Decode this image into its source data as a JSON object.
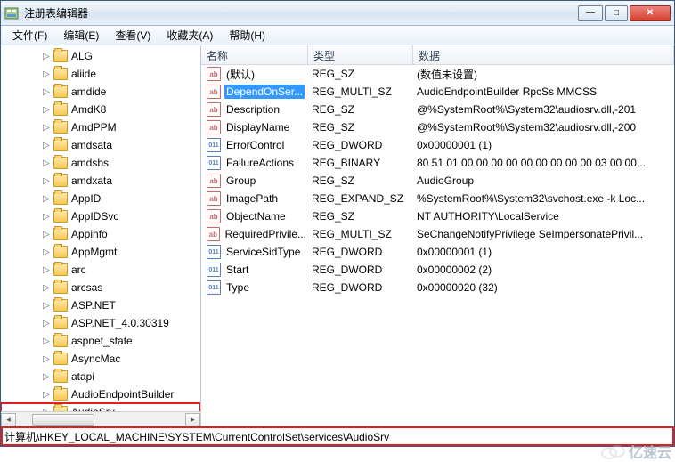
{
  "window": {
    "title": "注册表编辑器"
  },
  "menu": {
    "file": "文件(F)",
    "edit": "编辑(E)",
    "view": "查看(V)",
    "favorites": "收藏夹(A)",
    "help": "帮助(H)"
  },
  "tree": {
    "items": [
      {
        "label": "ALG"
      },
      {
        "label": "aliide"
      },
      {
        "label": "amdide"
      },
      {
        "label": "AmdK8"
      },
      {
        "label": "AmdPPM"
      },
      {
        "label": "amdsata"
      },
      {
        "label": "amdsbs"
      },
      {
        "label": "amdxata"
      },
      {
        "label": "AppID"
      },
      {
        "label": "AppIDSvc"
      },
      {
        "label": "Appinfo"
      },
      {
        "label": "AppMgmt"
      },
      {
        "label": "arc"
      },
      {
        "label": "arcsas"
      },
      {
        "label": "ASP.NET"
      },
      {
        "label": "ASP.NET_4.0.30319"
      },
      {
        "label": "aspnet_state"
      },
      {
        "label": "AsyncMac"
      },
      {
        "label": "atapi"
      },
      {
        "label": "AudioEndpointBuilder"
      },
      {
        "label": "AudioSrv"
      }
    ],
    "selected_index": 20
  },
  "columns": {
    "name": "名称",
    "type": "类型",
    "data": "数据"
  },
  "values": [
    {
      "icon": "str",
      "name": "(默认)",
      "type": "REG_SZ",
      "data": "(数值未设置)"
    },
    {
      "icon": "str",
      "name": "DependOnSer...",
      "type": "REG_MULTI_SZ",
      "data": "AudioEndpointBuilder RpcSs MMCSS",
      "selected": true
    },
    {
      "icon": "str",
      "name": "Description",
      "type": "REG_SZ",
      "data": "@%SystemRoot%\\System32\\audiosrv.dll,-201"
    },
    {
      "icon": "str",
      "name": "DisplayName",
      "type": "REG_SZ",
      "data": "@%SystemRoot%\\System32\\audiosrv.dll,-200"
    },
    {
      "icon": "bin",
      "name": "ErrorControl",
      "type": "REG_DWORD",
      "data": "0x00000001 (1)"
    },
    {
      "icon": "bin",
      "name": "FailureActions",
      "type": "REG_BINARY",
      "data": "80 51 01 00 00 00 00 00 00 00 00 00 03 00 00..."
    },
    {
      "icon": "str",
      "name": "Group",
      "type": "REG_SZ",
      "data": "AudioGroup"
    },
    {
      "icon": "str",
      "name": "ImagePath",
      "type": "REG_EXPAND_SZ",
      "data": "%SystemRoot%\\System32\\svchost.exe -k Loc..."
    },
    {
      "icon": "str",
      "name": "ObjectName",
      "type": "REG_SZ",
      "data": "NT AUTHORITY\\LocalService"
    },
    {
      "icon": "str",
      "name": "RequiredPrivile...",
      "type": "REG_MULTI_SZ",
      "data": "SeChangeNotifyPrivilege SeImpersonatePrivil..."
    },
    {
      "icon": "bin",
      "name": "ServiceSidType",
      "type": "REG_DWORD",
      "data": "0x00000001 (1)"
    },
    {
      "icon": "bin",
      "name": "Start",
      "type": "REG_DWORD",
      "data": "0x00000002 (2)"
    },
    {
      "icon": "bin",
      "name": "Type",
      "type": "REG_DWORD",
      "data": "0x00000020 (32)"
    }
  ],
  "statusbar": {
    "path": "计算机\\HKEY_LOCAL_MACHINE\\SYSTEM\\CurrentControlSet\\services\\AudioSrv"
  },
  "watermark": "亿速云"
}
